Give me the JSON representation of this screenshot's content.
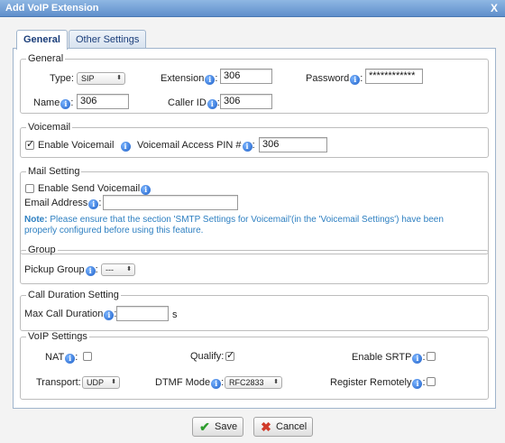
{
  "window": {
    "title": "Add VoIP Extension",
    "close_label": "X"
  },
  "tabs": [
    {
      "label": "General",
      "active": true
    },
    {
      "label": "Other Settings",
      "active": false
    }
  ],
  "general": {
    "legend": "General",
    "type_label": "Type:",
    "type_value": "SIP",
    "extension_label": "Extension",
    "extension_value": "306",
    "password_label": "Password",
    "password_value": "************",
    "name_label": "Name",
    "name_value": "306",
    "callerid_label": "Caller ID",
    "callerid_value": "306"
  },
  "voicemail": {
    "legend": "Voicemail",
    "enable_label": "Enable Voicemail",
    "enable_checked": true,
    "pin_label": "Voicemail Access PIN #",
    "pin_value": "306"
  },
  "mail": {
    "legend": "Mail Setting",
    "send_label": "Enable Send Voicemail",
    "send_checked": false,
    "email_label": "Email Address",
    "email_value": "",
    "note_prefix": "Note:",
    "note_text": " Please ensure that the section 'SMTP Settings for Voicemail'(in the 'Voicemail Settings') have been properly configured before using this feature."
  },
  "group": {
    "legend": "Group",
    "pickup_label": "Pickup Group",
    "pickup_value": "---"
  },
  "duration": {
    "legend": "Call Duration Setting",
    "max_label": "Max Call Duration",
    "max_value": "",
    "unit": "s"
  },
  "voip": {
    "legend": "VoIP Settings",
    "nat_label": "NAT",
    "nat_checked": false,
    "qualify_label": "Qualify:",
    "qualify_checked": true,
    "srtp_label": "Enable SRTP",
    "srtp_checked": false,
    "transport_label": "Transport:",
    "transport_value": "UDP",
    "dtmf_label": "DTMF Mode",
    "dtmf_value": "RFC2833",
    "register_label": "Register Remotely",
    "register_checked": false
  },
  "buttons": {
    "save": "Save",
    "cancel": "Cancel"
  },
  "colors": {
    "titlebar": "#6f9ad2",
    "link_blue": "#2d7fc1",
    "info_icon": "#1d5fc7",
    "save_icon": "#2e9d2e",
    "cancel_icon": "#d03a2a"
  }
}
